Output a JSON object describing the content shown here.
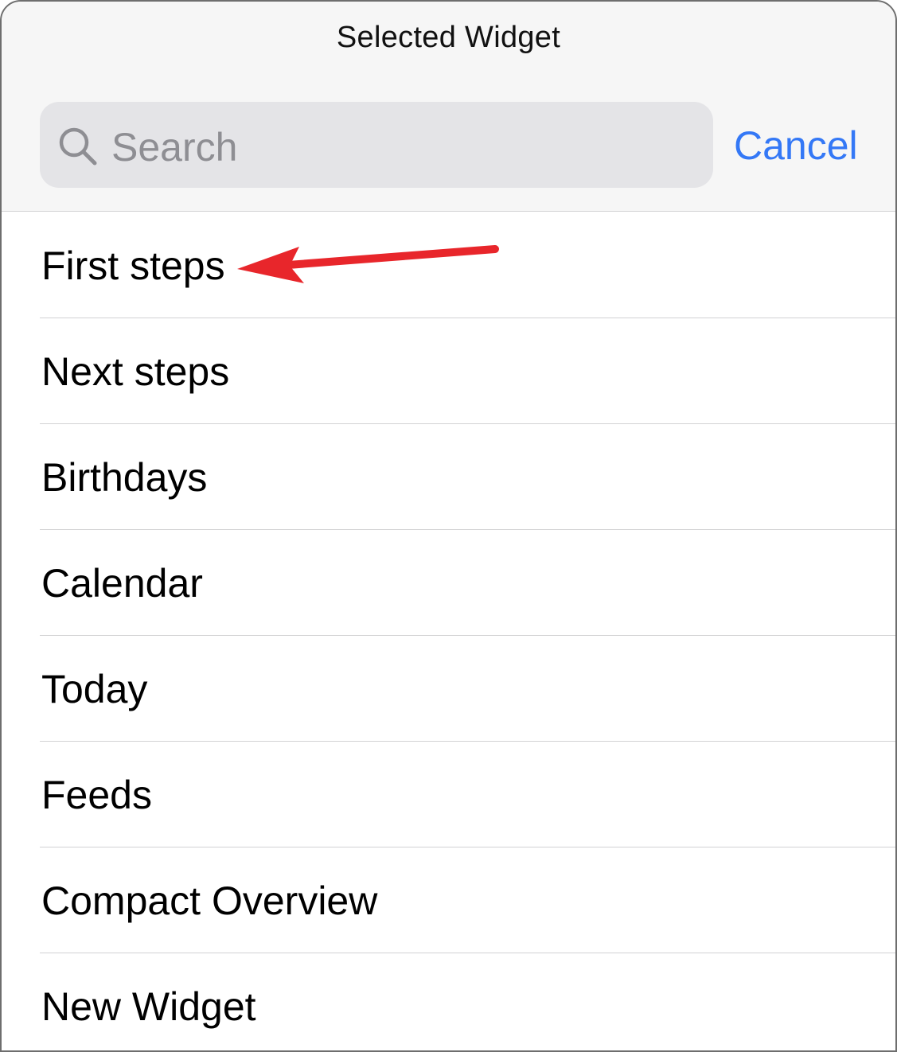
{
  "header": {
    "title": "Selected Widget"
  },
  "search": {
    "placeholder": "Search",
    "cancel_label": "Cancel"
  },
  "widgets": [
    {
      "label": "First steps"
    },
    {
      "label": "Next steps"
    },
    {
      "label": "Birthdays"
    },
    {
      "label": "Calendar"
    },
    {
      "label": "Today"
    },
    {
      "label": "Feeds"
    },
    {
      "label": "Compact Overview"
    },
    {
      "label": "New Widget"
    }
  ],
  "colors": {
    "accent": "#3478f6",
    "annotation_arrow": "#e8262b",
    "header_bg": "#f6f6f6",
    "search_bg": "#e4e4e7"
  },
  "annotation": {
    "icon": "red-arrow-icon",
    "points_to": "First steps"
  }
}
